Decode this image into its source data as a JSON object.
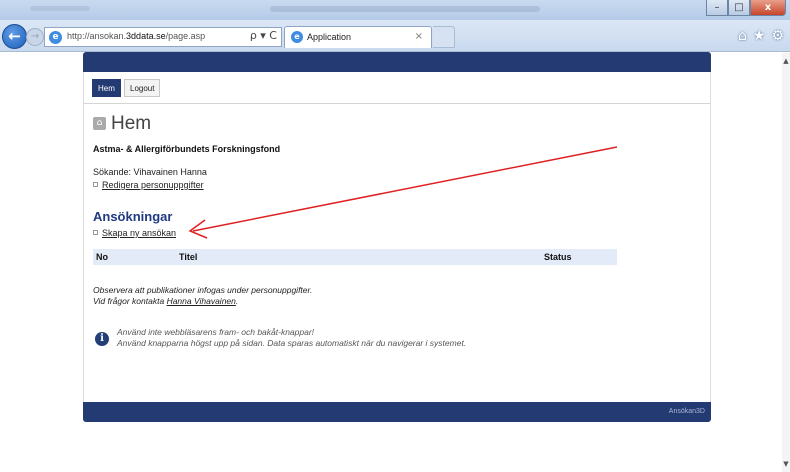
{
  "browser": {
    "url_prefix": "http://ansokan.",
    "url_domain": "3ddata.se",
    "url_path": "/page.asp",
    "tab_title": "Application",
    "tab_close": "×",
    "search_refresh": "ρ ▾ C",
    "back_glyph": "←",
    "forward_glyph": "→",
    "ie_glyph": "e",
    "home_glyph": "⌂",
    "favorites_glyph": "★",
    "tools_glyph": "⚙",
    "minimize_glyph": "–",
    "maximize_glyph": "□",
    "close_glyph": "x"
  },
  "menu": {
    "home_label": "Hem",
    "logout_label": "Logout"
  },
  "main": {
    "title": "Hem",
    "org_name": "Astma- & Allergiförbundets Forskningsfond",
    "applicant": "Sökande: Vihavainen Hanna",
    "edit_link": "Redigera personuppgifter",
    "section_title": "Ansökningar",
    "new_application_link": "Skapa ny ansökan",
    "table_columns": [
      "No",
      "Titel",
      "Status"
    ],
    "note_line1": "Observera att publikationer infogas under personuppgifter.",
    "note_line2_prefix": "Vid frågor kontakta ",
    "note_contact": "Hanna Vihavainen",
    "note_line2_suffix": ".",
    "warning_line1": "Använd inte webbläsarens fram- och bakåt-knappar!",
    "warning_line2": "Använd knapparna högst upp på sidan. Data sparas automatiskt när du navigerar i systemet.",
    "info_glyph": "i"
  },
  "footer": {
    "brand": "Ansökan3D"
  },
  "colors": {
    "header_bar": "#233a73",
    "section_title": "#1f3a82",
    "table_header_bg": "#e3ebf8",
    "annotation_arrow": "#e02020"
  }
}
